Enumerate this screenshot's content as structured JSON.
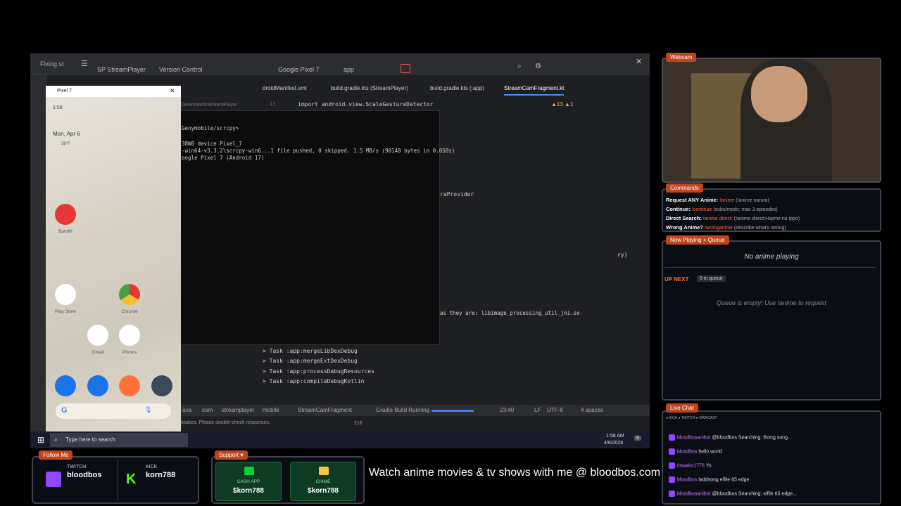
{
  "desktop": {
    "window_caption": "Fixing st",
    "studio": {
      "project": "SP StreamPlayer",
      "vcs": "Version Control",
      "device": "Google Pixel 7",
      "run_config": "app",
      "tabs": [
        "droidManifest.xml",
        "build.gradle.kts (StreamPlayer)",
        "build.gradle.kts (:app)",
        "StreamCamFragment.kt"
      ],
      "code_line_number": "13",
      "code_line": "import android.view.ScaleGestureDetector",
      "code_fragment": "raProvider",
      "right_snippet": "ry)",
      "logcat_line": "as they are: libimage_processing_util_jni.so",
      "build_lines": [
        "> Task :app:mergeLibDexDebug",
        "> Task :app:mergeExtDexDebug",
        "> Task :app:processDebugResources",
        "> Task :app:compileDebugKotlin"
      ],
      "warnings_badge": "▲13 ▲1",
      "status": {
        "breadcrumb": [
          "ava",
          "com",
          "streamplayer",
          "mobile",
          "StreamCamFragment"
        ],
        "build_status": "Gradle Build Running",
        "position": "23:40",
        "line_ending": "LF",
        "encoding": "UTF-8",
        "indent": "4 spaces",
        "notice": "istakes. Please double-check responses.",
        "count": "216"
      }
    },
    "terminal": {
      "path": "Genymobile/scrcpy>",
      "lines": [
        "38W0                  device  Pixel_7",
        "-win64-v3.3.2\\scrcpy-win6...1 file pushed, 0 skipped. 1.5 MB/s (90148 bytes in 0.058s)",
        "oogle Pixel 7 (Android 17)"
      ],
      "downloads_path": "Downloads\\StreamPlayer"
    },
    "phone": {
      "window_title": "Pixel 7",
      "time": "1:58",
      "date": "Mon, Apr 6",
      "temp": "38°F",
      "apps": [
        {
          "label": "Bandlit",
          "color": "#e53935"
        },
        {
          "label": "Play Store",
          "color": "#ffffff"
        },
        {
          "label": "Chrome",
          "color": "#ffffff"
        },
        {
          "label": "Gmail",
          "color": "#ffffff"
        },
        {
          "label": "Photos",
          "color": "#ffffff"
        }
      ],
      "dock": [
        "phone",
        "messages",
        "firefox",
        "camera"
      ],
      "search_g": "G"
    },
    "taskbar": {
      "search_placeholder": "Type here to search",
      "time": "1:58 AM",
      "date": "4/6/2026",
      "notif_count": "5"
    }
  },
  "webcam": {
    "label": "Webcam"
  },
  "commands": {
    "label": "Commands",
    "items": [
      {
        "name": "Request ANY Anime:",
        "cmd": "!anime",
        "desc": "(!anime naruto)"
      },
      {
        "name": "Continue:",
        "cmd": "!continue",
        "desc": "(subs/mods; max 3 episodes)"
      },
      {
        "name": "Direct Search:",
        "cmd": "!anime direct:",
        "desc": "(!anime direct:Hajime no ippo)"
      },
      {
        "name": "Wrong Anime?",
        "cmd": "!wronganime",
        "desc": "(describe what's wrong)"
      }
    ]
  },
  "queue": {
    "label": "Now Playing + Queue",
    "now_playing": "No anime playing",
    "up_next": "UP NEXT",
    "queue_count": "0 in queue",
    "empty_msg": "Queue is empty! Use !anime to request"
  },
  "chat": {
    "label": "Live Chat",
    "platforms": "● KICK  ● TWITCH  ● OWNCAST",
    "messages": [
      {
        "user": "bloodbosanibot",
        "text": "@bloodbos Searching: thong song..."
      },
      {
        "user": "bloodbos",
        "text": "hello world"
      },
      {
        "user": "itswako1776",
        "text": "Yo"
      },
      {
        "user": "bloodbos",
        "text": "laddsong eifile 65 edge"
      },
      {
        "user": "bloodbosanibot",
        "text": "@bloodbos Searching: eifile 65 edge..."
      }
    ]
  },
  "follow": {
    "label": "Follow Me",
    "twitch_label": "TWITCH",
    "twitch_name": "bloodbos",
    "kick_label": "KICK",
    "kick_name": "korn788"
  },
  "support": {
    "label": "Support ♥",
    "cashapp_label": "CASH APP",
    "cashapp_value": "$korn788",
    "chime_label": "CHIME",
    "chime_value": "$korn788"
  },
  "banner": "Watch anime movies & tv shows with me @ bloodbos.com",
  "colors": {
    "accent": "#c0451f",
    "twitch": "#9146ff",
    "kick": "#53fc18",
    "panel_border": "#3e4150"
  }
}
